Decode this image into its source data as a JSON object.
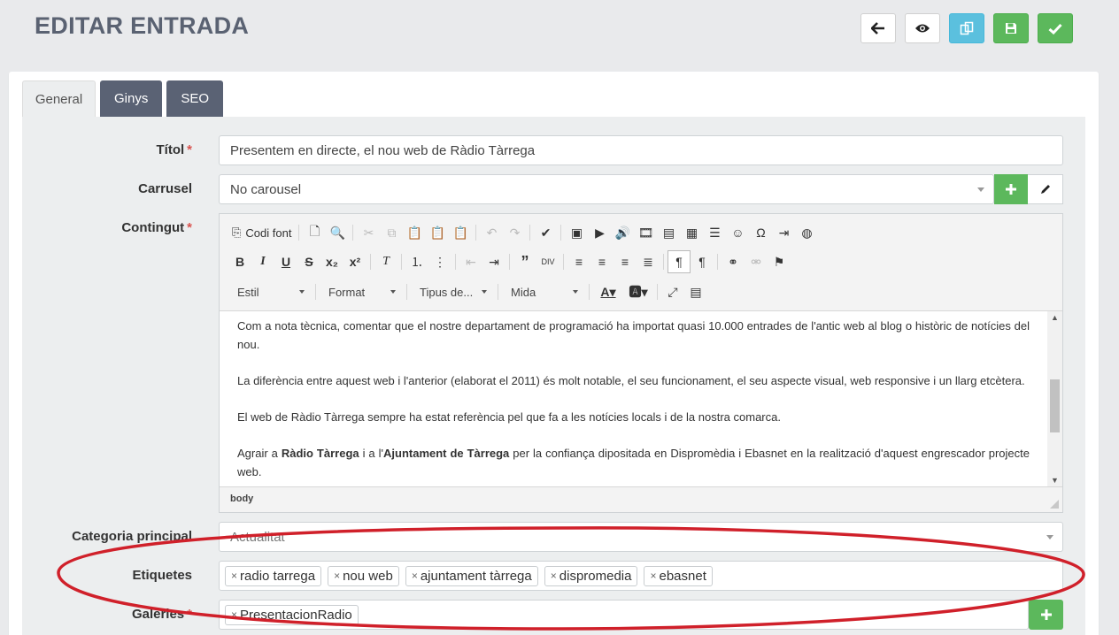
{
  "page_title": "EDITAR ENTRADA",
  "top_actions": [
    {
      "name": "back-button",
      "icon": "arrow-left-icon"
    },
    {
      "name": "preview-button",
      "icon": "eye-icon"
    },
    {
      "name": "duplicate-button",
      "icon": "copy-icon"
    },
    {
      "name": "save-button",
      "icon": "floppy-disk-icon"
    },
    {
      "name": "save-close-button",
      "icon": "check-icon"
    }
  ],
  "tabs": [
    {
      "label": "General",
      "active": true
    },
    {
      "label": "Ginys",
      "active": false
    },
    {
      "label": "SEO",
      "active": false
    }
  ],
  "form": {
    "title_label": "Títol",
    "title_value": "Presentem en directe, el nou web de Ràdio Tàrrega",
    "carousel_label": "Carrusel",
    "carousel_value": "No carousel",
    "content_label": "Contingut",
    "category_label": "Categoria principal",
    "category_value": "Actualitat",
    "tags_label": "Etiquetes",
    "tags": [
      "radio tarrega",
      "nou web",
      "ajuntament tàrrega",
      "dispromedia",
      "ebasnet"
    ],
    "galleries_label": "Galeries",
    "galleries": [
      "PresentacionRadio"
    ],
    "required_mark": "*"
  },
  "editor": {
    "source_label": "Codi font",
    "combos": {
      "style": "Estil",
      "format": "Format",
      "font": "Tipus de...",
      "size": "Mida"
    },
    "paragraphs": [
      "Com a nota tècnica, comentar que el nostre departament de programació ha importat quasi 10.000 entrades de l'antic web al blog o històric de notícies del nou.",
      "La diferència entre aquest web i l'anterior (elaborat el 2011) és molt notable, el seu funcionament, el seu aspecte visual, web responsive i un llarg etcètera.",
      "El web de Ràdio Tàrrega sempre ha estat referència pel que fa a les notícies locals i de la nostra comarca."
    ],
    "last_paragraph": {
      "p1": "Agrair a ",
      "b1": "Ràdio Tàrrega",
      "p2": " i a l'",
      "b2": "Ajuntament de Tàrrega",
      "p3": " per la confiança dipositada en Dispromèdia i Ebasnet en la realització d'aquest engrescador projecte web."
    },
    "status_path": "body"
  },
  "colors": {
    "success": "#5cb85c",
    "info": "#5bc0de",
    "tab_dark": "#5a6274",
    "required": "#d9534f",
    "annotation": "#d0202a"
  }
}
